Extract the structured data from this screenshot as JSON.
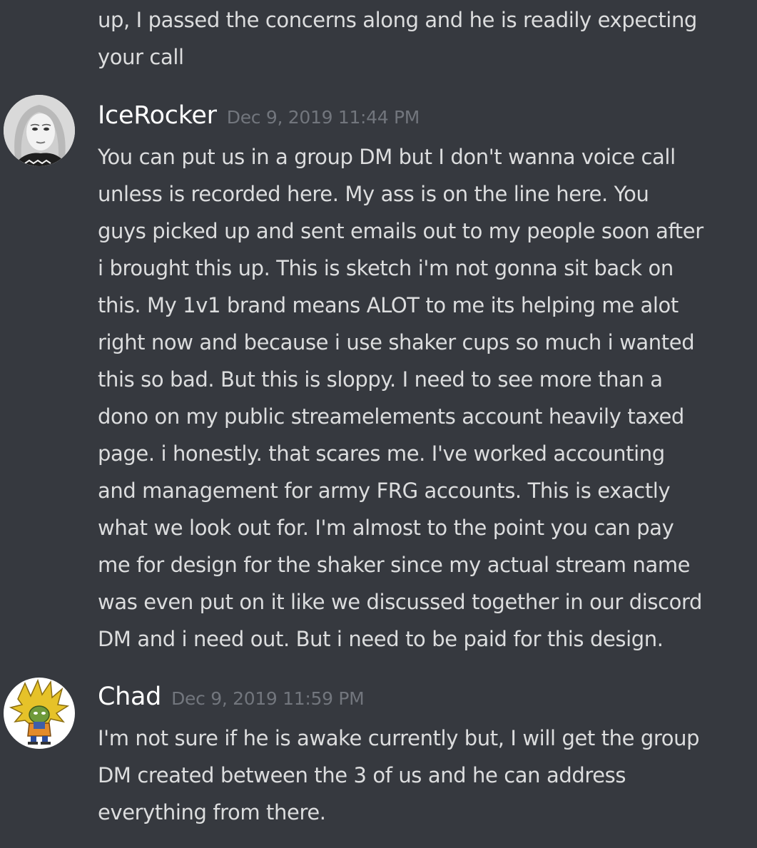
{
  "continuation": {
    "lines": [
      "up, I passed the concerns along and he is readily expecting",
      "your call"
    ]
  },
  "messages": [
    {
      "username": "IceRocker",
      "timestamp": "Dec 9, 2019 11:44 PM",
      "avatar_icon": "user-avatar-portrait-icon",
      "lines": [
        "You can put us in a group DM but I don't wanna voice call",
        "unless is recorded here. My ass is on the line here. You",
        "guys picked up and sent emails out to my people soon after",
        "i brought this up. This is sketch i'm not gonna sit back on",
        "this. My 1v1 brand means ALOT to me its helping me alot",
        "right now and because i use shaker cups so much i wanted",
        "this so bad. But this is sloppy. I need to see more than a",
        "dono on my public streamelements account heavily taxed",
        "page. i honestly. that scares me. I've worked accounting",
        "and management for army FRG accounts. This is exactly",
        "what we look out for. I'm almost to the point you can pay",
        "me for design for the shaker since my actual stream name",
        "was even put on it like we discussed together in our discord",
        "DM and i need out. But i need to be paid for this design."
      ]
    },
    {
      "username": "Chad",
      "timestamp": "Dec 9, 2019 11:59 PM",
      "avatar_icon": "user-avatar-cartoon-icon",
      "lines": [
        "I'm not sure if he is awake currently but, I will get the group",
        "DM created between the 3 of us and he can address",
        "everything from there."
      ]
    }
  ],
  "colors": {
    "background": "#36393f",
    "text": "#dcddde",
    "username": "#ffffff",
    "timestamp": "#72767d"
  }
}
